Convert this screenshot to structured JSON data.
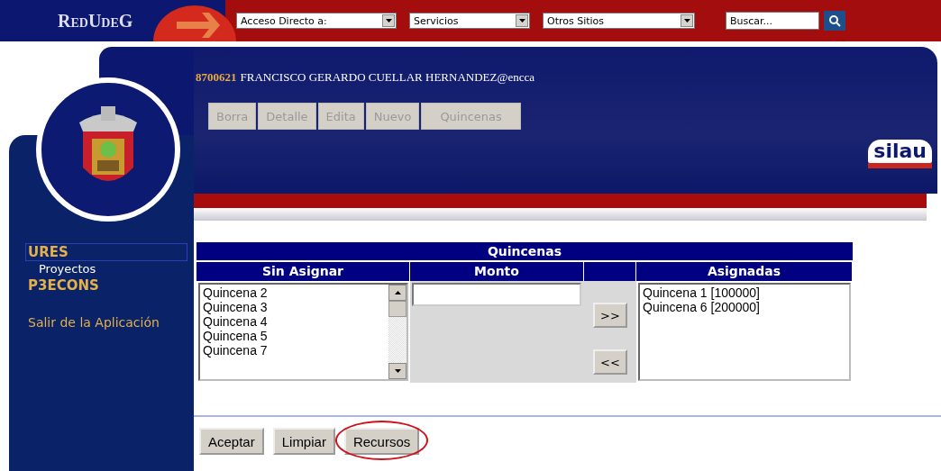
{
  "topbar": {
    "logo": "RedUdeG",
    "dropdowns": [
      "Acceso Directo a:",
      "Servicios",
      "Otros Sitios"
    ],
    "search": {
      "placeholder": "Buscar..."
    }
  },
  "header": {
    "user_id": "8700621",
    "user_name": "FRANCISCO GERARDO CUELLAR HERNANDEZ@encca",
    "brand": "silau",
    "actions": [
      {
        "label": "Borra",
        "disabled": true
      },
      {
        "label": "Detalle",
        "disabled": true
      },
      {
        "label": "Edita",
        "disabled": true
      },
      {
        "label": "Nuevo",
        "disabled": true
      },
      {
        "label": "Quincenas",
        "disabled": true
      }
    ]
  },
  "sidebar": {
    "items": [
      {
        "label": "URES",
        "kind": "module",
        "selected": true
      },
      {
        "label": "Proyectos",
        "kind": "sub",
        "selected": false
      },
      {
        "label": "P3ECONS",
        "kind": "module",
        "selected": false
      },
      {
        "label": "Salir de la Aplicación",
        "kind": "exit",
        "selected": false
      }
    ]
  },
  "quincenas": {
    "title": "Quincenas",
    "columns": [
      "Sin Asignar",
      "Monto",
      "Asignadas"
    ],
    "unassigned": [
      "Quincena 2",
      "Quincena 3",
      "Quincena 4",
      "Quincena 5",
      "Quincena 7"
    ],
    "move_buttons": [
      ">>",
      "<<"
    ],
    "assigned": [
      "Quincena 1 [100000]",
      "Quincena 6 [200000]"
    ]
  },
  "buttons": [
    {
      "label": "Aceptar",
      "circled": false
    },
    {
      "label": "Limpiar",
      "circled": false
    },
    {
      "label": "Recursos",
      "circled": true
    }
  ]
}
